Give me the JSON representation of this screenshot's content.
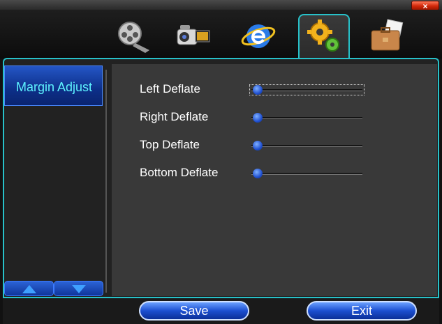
{
  "window": {
    "close_label": "×"
  },
  "tabs": [
    {
      "icon": "film-reel-icon"
    },
    {
      "icon": "camcorder-icon"
    },
    {
      "icon": "internet-explorer-icon"
    },
    {
      "icon": "gears-icon"
    },
    {
      "icon": "briefcase-icon"
    }
  ],
  "sidebar": {
    "items": [
      {
        "label": "Margin Adjust"
      }
    ],
    "nav": {
      "up_icon": "triangle-up-icon",
      "down_icon": "triangle-down-icon"
    }
  },
  "main": {
    "rows": [
      {
        "label": "Left Deflate",
        "value": 0
      },
      {
        "label": "Right Deflate",
        "value": 0
      },
      {
        "label": "Top Deflate",
        "value": 0
      },
      {
        "label": "Bottom Deflate",
        "value": 0
      }
    ]
  },
  "buttons": {
    "save_label": "Save",
    "exit_label": "Exit"
  },
  "colors": {
    "accent": "#27c1c9",
    "label_cyan": "#5ef3ff",
    "button_blue": "#1c4fd0"
  }
}
